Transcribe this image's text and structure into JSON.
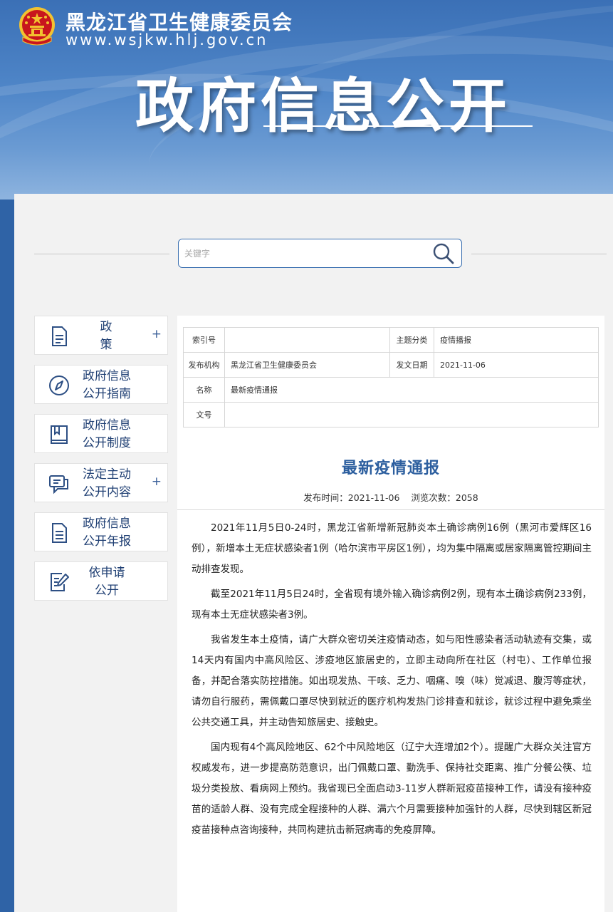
{
  "header": {
    "site_name": "黑龙江省卫生健康委员会",
    "site_url": "www.wsjkw.hlj.gov.cn",
    "banner_title": "政府信息公开"
  },
  "search": {
    "placeholder": "关键字"
  },
  "sidebar": {
    "items": [
      {
        "label": "政 策",
        "has_plus": true,
        "icon": "document-icon"
      },
      {
        "label": "政府信息\n公开指南",
        "has_plus": false,
        "icon": "compass-icon"
      },
      {
        "label": "政府信息\n公开制度",
        "has_plus": false,
        "icon": "book-icon"
      },
      {
        "label": "法定主动\n公开内容",
        "has_plus": true,
        "icon": "chat-icon"
      },
      {
        "label": "政府信息\n公开年报",
        "has_plus": false,
        "icon": "report-icon"
      },
      {
        "label": "依申请\n公开",
        "has_plus": false,
        "icon": "edit-form-icon"
      }
    ],
    "plus_symbol": "+"
  },
  "meta_table": {
    "index_label": "索引号",
    "index_value": "",
    "category_label": "主题分类",
    "category_value": "疫情播报",
    "publisher_label": "发布机构",
    "publisher_value": "黑龙江省卫生健康委员会",
    "date_label": "发文日期",
    "date_value": "2021-11-06",
    "name_label": "名称",
    "name_value": "最新疫情通报",
    "docno_label": "文号",
    "docno_value": ""
  },
  "article": {
    "title": "最新疫情通报",
    "publish_time": "发布时间：2021-11-06",
    "views": "浏览次数：2058",
    "paragraphs": [
      "2021年11月5日0-24时，黑龙江省新增新冠肺炎本土确诊病例16例（黑河市爱辉区16例），新增本土无症状感染者1例（哈尔滨市平房区1例），均为集中隔离或居家隔离管控期间主动排查发现。",
      "截至2021年11月5日24时，全省现有境外输入确诊病例2例，现有本土确诊病例233例，现有本土无症状感染者3例。",
      "我省发生本土疫情，请广大群众密切关注疫情动态，如与阳性感染者活动轨迹有交集，或14天内有国内中高风险区、涉疫地区旅居史的，立即主动向所在社区（村屯）、工作单位报备，并配合落实防控措施。如出现发热、干咳、乏力、咽痛、嗅（味）觉减退、腹泻等症状，请勿自行服药，需佩戴口罩尽快到就近的医疗机构发热门诊排查和就诊，就诊过程中避免乘坐公共交通工具，并主动告知旅居史、接触史。",
      "国内现有4个高风险地区、62个中风险地区（辽宁大连增加2个）。提醒广大群众关注官方权威发布，进一步提高防范意识，出门佩戴口罩、勤洗手、保持社交距离、推广分餐公筷、垃圾分类投放、看病网上预约。我省现已全面启动3-11岁人群新冠疫苗接种工作，请没有接种疫苗的适龄人群、没有完成全程接种的人群、满六个月需要接种加强针的人群，尽快到辖区新冠疫苗接种点咨询接种，共同构建抗击新冠病毒的免疫屏障。"
    ]
  },
  "colors": {
    "header_blue": "#3b70b6",
    "title_blue": "#2d5f9f",
    "sidebar_text": "#1f3f73",
    "emblem_red": "#c8161d",
    "emblem_gold": "#f2c230"
  }
}
